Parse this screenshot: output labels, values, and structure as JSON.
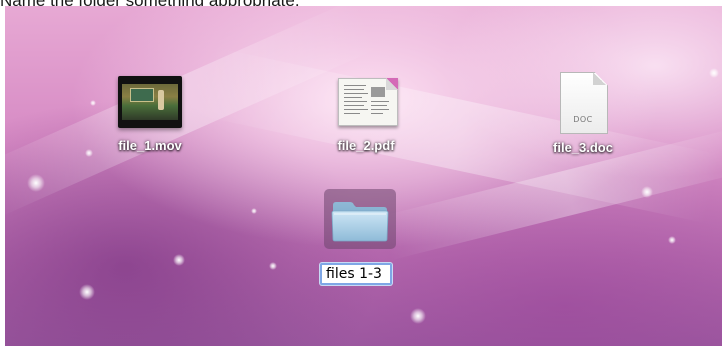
{
  "instruction": "Name the folder something appropriate.",
  "desktop": {
    "files": [
      {
        "label": "file_1.mov",
        "icon": "movie-file-icon"
      },
      {
        "label": "file_2.pdf",
        "icon": "pdf-file-icon"
      },
      {
        "label": "file_3.doc",
        "icon": "doc-file-icon"
      }
    ],
    "doc_badge": "DOC",
    "new_folder": {
      "icon": "folder-icon",
      "name_value": "files 1-3"
    }
  },
  "colors": {
    "selection_border": "#7fa7e6",
    "folder_fill": "#a9cfe6"
  }
}
